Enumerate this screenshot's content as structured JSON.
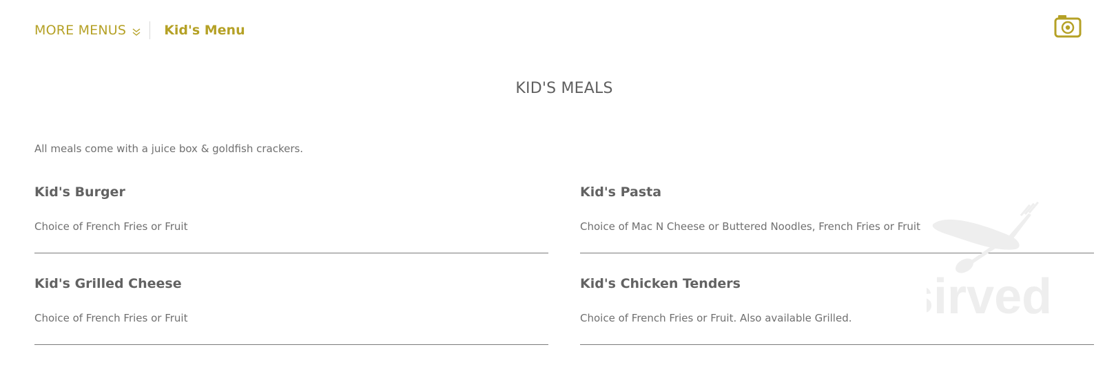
{
  "header": {
    "more_menus_label": "MORE MENUS",
    "current_menu": "Kid's Menu"
  },
  "section": {
    "title": "KID'S MEALS",
    "description": "All meals come with a juice box & goldfish crackers."
  },
  "items": [
    {
      "name": "Kid's Burger",
      "description": "Choice of French Fries or Fruit"
    },
    {
      "name": "Kid's Pasta",
      "description": "Choice of Mac N Cheese or Buttered Noodles, French Fries or Fruit"
    },
    {
      "name": "Kid's Grilled Cheese",
      "description": "Choice of French Fries or Fruit"
    },
    {
      "name": "Kid's Chicken Tenders",
      "description": "Choice of French Fries or Fruit. Also available Grilled."
    }
  ],
  "watermark": {
    "text": "sirved"
  },
  "colors": {
    "accent": "#b5a126",
    "text": "#666666",
    "divider": "#7a7a7a"
  },
  "icons": [
    "chevron-double-down-icon",
    "camera-icon",
    "fork-spoon-icon"
  ]
}
